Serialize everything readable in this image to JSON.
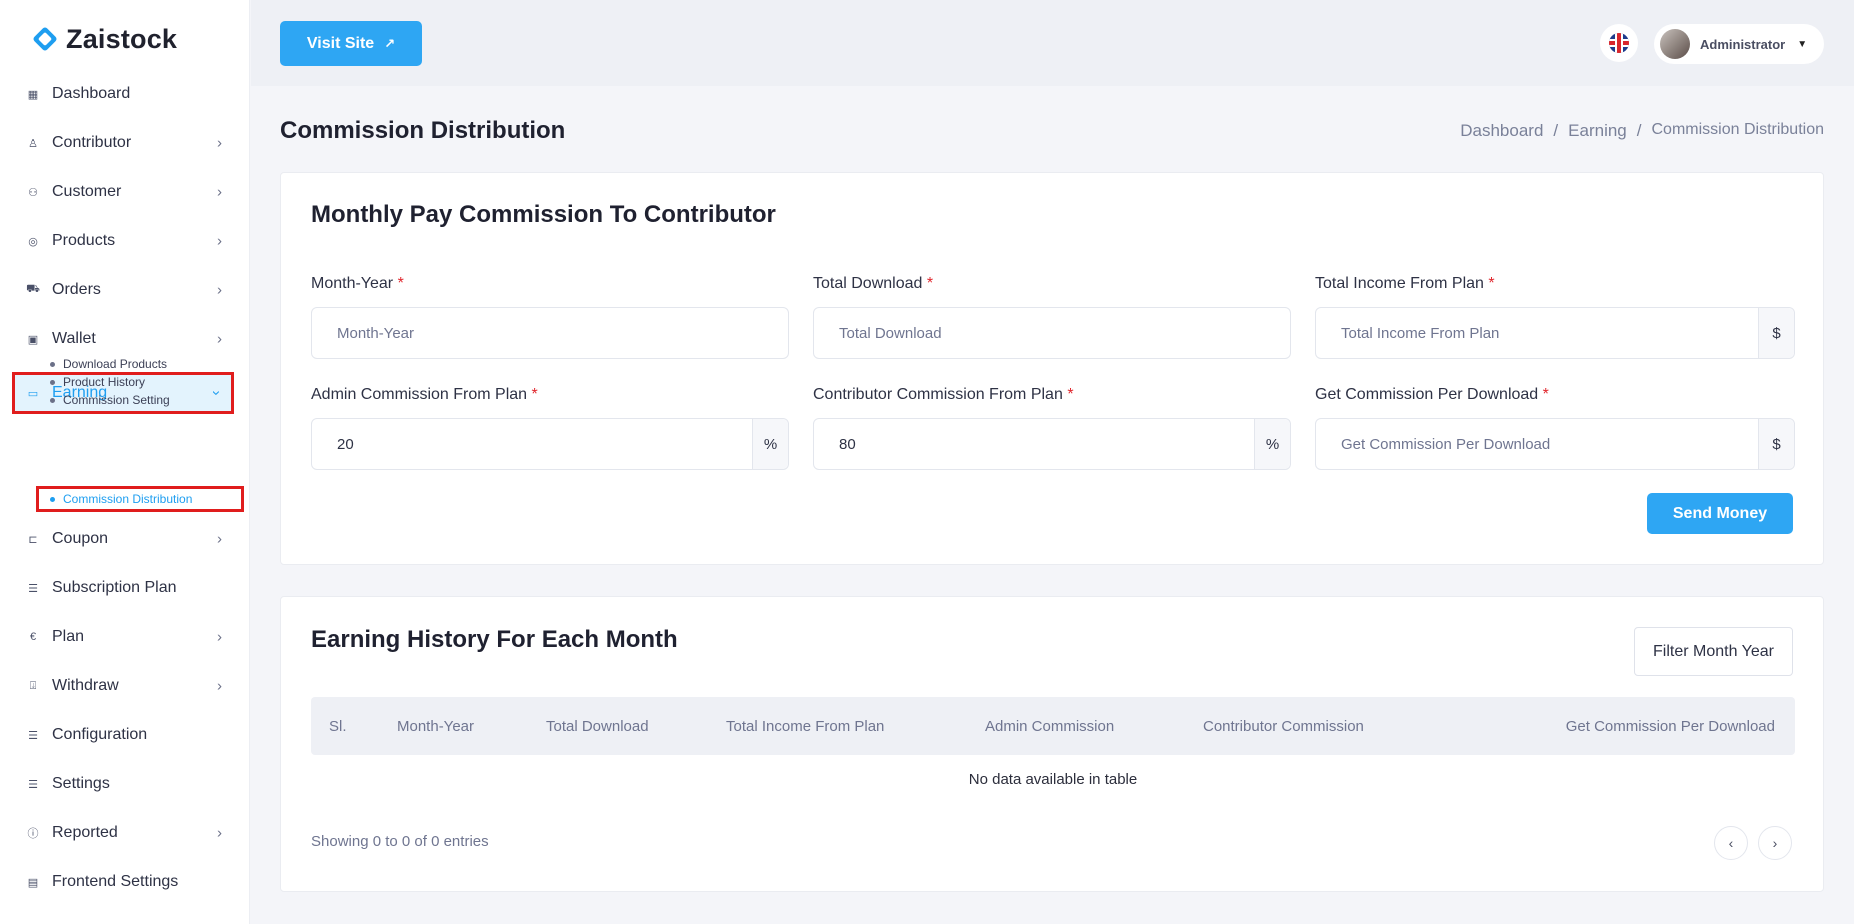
{
  "brand": {
    "name": "Zaistock"
  },
  "sidebar": {
    "items": [
      {
        "label": "Dashboard",
        "icon": "grid-icon",
        "has_children": false
      },
      {
        "label": "Contributor",
        "icon": "user-icon",
        "has_children": true
      },
      {
        "label": "Customer",
        "icon": "users-icon",
        "has_children": true
      },
      {
        "label": "Products",
        "icon": "product-icon",
        "has_children": true
      },
      {
        "label": "Orders",
        "icon": "cart-icon",
        "has_children": true
      },
      {
        "label": "Wallet",
        "icon": "wallet-icon",
        "has_children": true
      },
      {
        "label": "Earning",
        "icon": "money-icon",
        "has_children": true,
        "active": true
      },
      {
        "label": "Coupon",
        "icon": "ticket-icon",
        "has_children": true
      },
      {
        "label": "Subscription Plan",
        "icon": "stack-icon",
        "has_children": false
      },
      {
        "label": "Plan",
        "icon": "euro-icon",
        "has_children": true
      },
      {
        "label": "Withdraw",
        "icon": "withdraw-icon",
        "has_children": true
      },
      {
        "label": "Configuration",
        "icon": "stack-icon",
        "has_children": false
      },
      {
        "label": "Settings",
        "icon": "stack-icon",
        "has_children": false
      },
      {
        "label": "Reported",
        "icon": "info-icon",
        "has_children": true
      },
      {
        "label": "Frontend Settings",
        "icon": "layout-icon",
        "has_children": false
      }
    ],
    "earning_sub": [
      {
        "label": "Download Products"
      },
      {
        "label": "Product History"
      },
      {
        "label": "Commission Setting"
      },
      {
        "label": "Commission Distribution",
        "active": true
      }
    ]
  },
  "topbar": {
    "visit_site_label": "Visit Site",
    "user_name": "Administrator"
  },
  "page": {
    "title": "Commission Distribution",
    "breadcrumb": [
      "Dashboard",
      "Earning",
      "Commission Distribution"
    ]
  },
  "form": {
    "title": "Monthly Pay Commission To Contributor",
    "fields": {
      "month_year": {
        "label": "Month-Year",
        "placeholder": "Month-Year"
      },
      "total_download": {
        "label": "Total Download",
        "placeholder": "Total Download"
      },
      "total_income": {
        "label": "Total Income From Plan",
        "placeholder": "Total Income From Plan",
        "addon": "$"
      },
      "admin_commission": {
        "label": "Admin Commission From Plan",
        "value": "20",
        "addon": "%"
      },
      "contributor_commission": {
        "label": "Contributor Commission From Plan",
        "value": "80",
        "addon": "%"
      },
      "per_download": {
        "label": "Get Commission Per Download",
        "placeholder": "Get Commission Per Download",
        "addon": "$"
      }
    },
    "required_mark": "*",
    "submit_label": "Send Money"
  },
  "history": {
    "title": "Earning History For Each Month",
    "filter_label": "Filter Month Year",
    "columns": [
      "Sl.",
      "Month-Year",
      "Total Download",
      "Total Income From Plan",
      "Admin Commission",
      "Contributor Commission",
      "Get Commission Per Download"
    ],
    "empty_message": "No data available in table",
    "showing": "Showing 0 to 0 of 0 entries",
    "prev_label": "‹",
    "next_label": "›"
  },
  "colors": {
    "accent": "#2ea6f3",
    "highlight": "#e01d1d",
    "required": "#e0242b"
  }
}
